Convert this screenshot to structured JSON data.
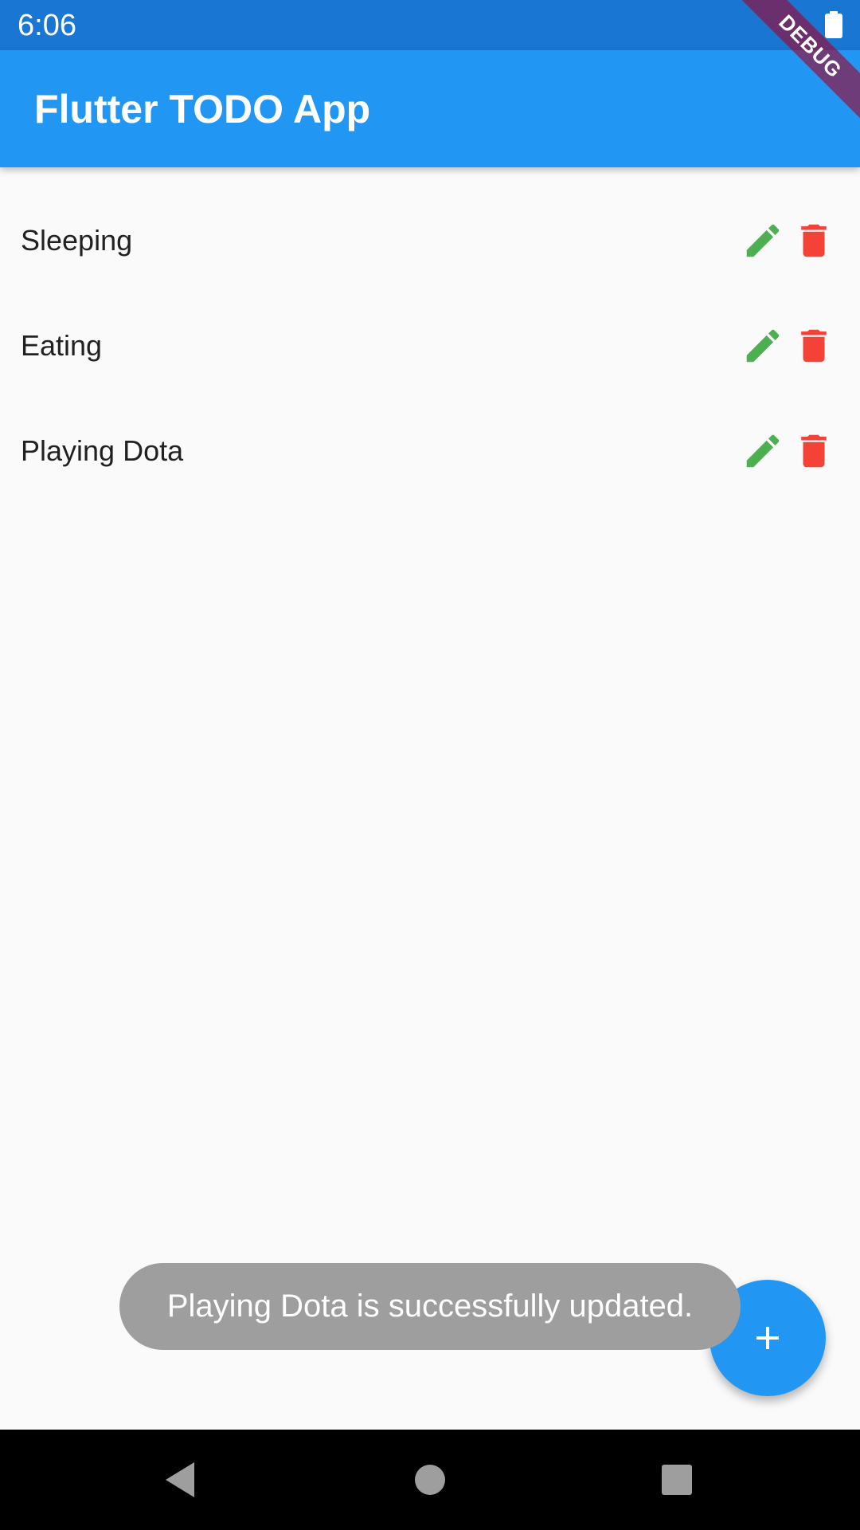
{
  "status_bar": {
    "time": "6:06",
    "battery_icon": "battery-full-icon"
  },
  "debug_banner": {
    "label": "DEBUG"
  },
  "app_bar": {
    "title": "Flutter TODO App",
    "color": "#2196f3"
  },
  "todos": [
    {
      "label": "Sleeping",
      "edit_icon": "pencil-icon",
      "delete_icon": "trash-icon"
    },
    {
      "label": "Eating",
      "edit_icon": "pencil-icon",
      "delete_icon": "trash-icon"
    },
    {
      "label": "Playing Dota",
      "edit_icon": "pencil-icon",
      "delete_icon": "trash-icon"
    }
  ],
  "colors": {
    "edit": "#4caf50",
    "delete": "#f44336",
    "fab": "#2196f3",
    "status_bar": "#1976d2",
    "toast": "#9e9e9e"
  },
  "toast": {
    "message": "Playing Dota is successfully updated."
  },
  "fab": {
    "icon": "plus-icon"
  },
  "nav_bar": {
    "back_icon": "triangle-back-icon",
    "home_icon": "circle-home-icon",
    "recents_icon": "square-recents-icon"
  }
}
